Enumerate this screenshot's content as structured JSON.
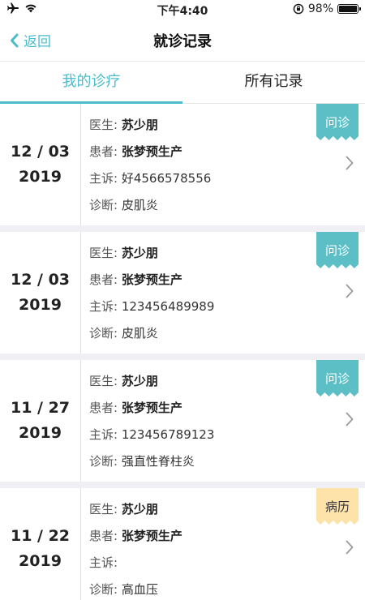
{
  "status_bar": {
    "time": "下午4:40",
    "battery_text": "98%",
    "battery_level": 0.98,
    "icons": [
      "airplane-icon",
      "wifi-icon",
      "orientation-lock-icon",
      "battery-icon"
    ]
  },
  "nav": {
    "back_label": "返回",
    "title": "就诊记录"
  },
  "tabs": [
    {
      "label": "我的诊疗",
      "active": true
    },
    {
      "label": "所有记录",
      "active": false
    }
  ],
  "labels": {
    "doctor": "医生:",
    "patient": "患者:",
    "complaint": "主诉:",
    "diagnosis": "诊断:"
  },
  "colors": {
    "accent": "#4bbccb",
    "badge_consult": "#5dbfc6",
    "badge_record": "#fde2a9",
    "divider": "#efeff4"
  },
  "records": [
    {
      "date_md": "12 / 03",
      "year": "2019",
      "doctor": "苏少朋",
      "patient": "张梦预生产",
      "complaint": "好4566578556",
      "diagnosis": "皮肌炎",
      "badge": "问诊",
      "badge_type": "consult"
    },
    {
      "date_md": "12 / 03",
      "year": "2019",
      "doctor": "苏少朋",
      "patient": "张梦预生产",
      "complaint": "123456489989",
      "diagnosis": "皮肌炎",
      "badge": "问诊",
      "badge_type": "consult"
    },
    {
      "date_md": "11 / 27",
      "year": "2019",
      "doctor": "苏少朋",
      "patient": "张梦预生产",
      "complaint": "123456789123",
      "diagnosis": "强直性脊柱炎",
      "badge": "问诊",
      "badge_type": "consult"
    },
    {
      "date_md": "11 / 22",
      "year": "2019",
      "doctor": "苏少朋",
      "patient": "张梦预生产",
      "complaint": "",
      "diagnosis": "高血压",
      "badge": "病历",
      "badge_type": "record"
    }
  ]
}
